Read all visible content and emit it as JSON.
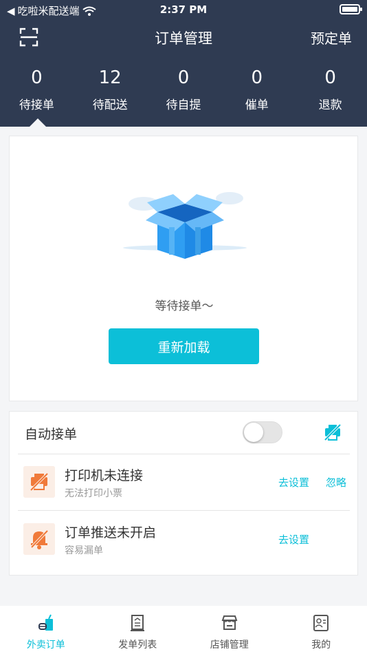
{
  "status_bar": {
    "back_app": "吃啦米配送端",
    "time": "2:37 PM"
  },
  "header": {
    "title": "订单管理",
    "reserve_label": "预定单"
  },
  "stats": [
    {
      "value": "0",
      "label": "待接单"
    },
    {
      "value": "12",
      "label": "待配送"
    },
    {
      "value": "0",
      "label": "待自提"
    },
    {
      "value": "0",
      "label": "催单"
    },
    {
      "value": "0",
      "label": "退款"
    }
  ],
  "empty_state": {
    "message": "等待接单～",
    "reload_label": "重新加载"
  },
  "settings": {
    "auto_accept_label": "自动接单",
    "auto_accept_on": false,
    "alerts": [
      {
        "title": "打印机未连接",
        "subtitle": "无法打印小票",
        "set_label": "去设置",
        "ignore_label": "忽略"
      },
      {
        "title": "订单推送未开启",
        "subtitle": "容易漏单",
        "set_label": "去设置"
      }
    ]
  },
  "tabbar": [
    {
      "label": "外卖订单",
      "icon": "takeout-icon",
      "active": true
    },
    {
      "label": "发单列表",
      "icon": "order-list-icon",
      "active": false
    },
    {
      "label": "店铺管理",
      "icon": "store-icon",
      "active": false
    },
    {
      "label": "我的",
      "icon": "profile-icon",
      "active": false
    }
  ],
  "colors": {
    "header_bg": "#2f3b52",
    "accent": "#0cbfd8",
    "warning": "#f07a3a"
  }
}
